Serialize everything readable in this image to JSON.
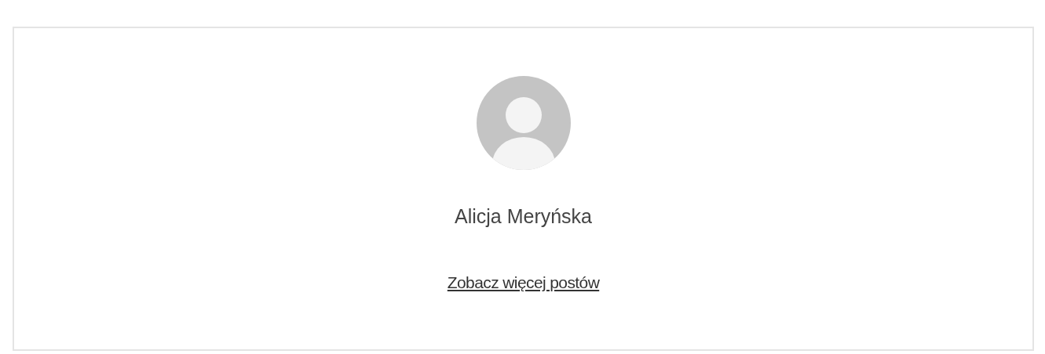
{
  "author": {
    "name": "Alicja Meryńska",
    "link": "Zobacz więcej postów"
  }
}
